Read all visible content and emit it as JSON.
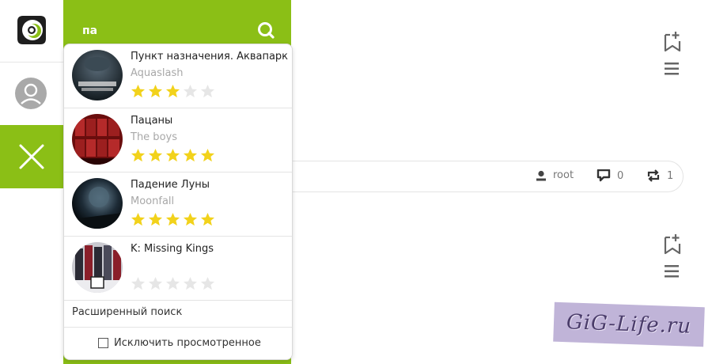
{
  "search": {
    "value": "па"
  },
  "results": [
    {
      "title": "Пункт назначения. Аквапарк",
      "subtitle": "Aquaslash",
      "rating": 3,
      "max_rating": 5
    },
    {
      "title": "Пацаны",
      "subtitle": "The boys",
      "rating": 5,
      "max_rating": 5
    },
    {
      "title": "Падение Луны",
      "subtitle": "Moonfall",
      "rating": 5,
      "max_rating": 5
    },
    {
      "title": "K: Missing Kings",
      "subtitle": "",
      "rating": 0,
      "max_rating": 5
    }
  ],
  "advanced_search_label": "Расширенный поиск",
  "exclude_watched_label": "Исключить просмотренное",
  "post_meta": {
    "author": "root",
    "comments": "0",
    "reposts": "1"
  },
  "watermark_text": "GiG-Life.ru",
  "colors": {
    "accent": "#8bbf16",
    "star_filled": "#f2d21b",
    "star_empty": "#e6e6e6"
  }
}
